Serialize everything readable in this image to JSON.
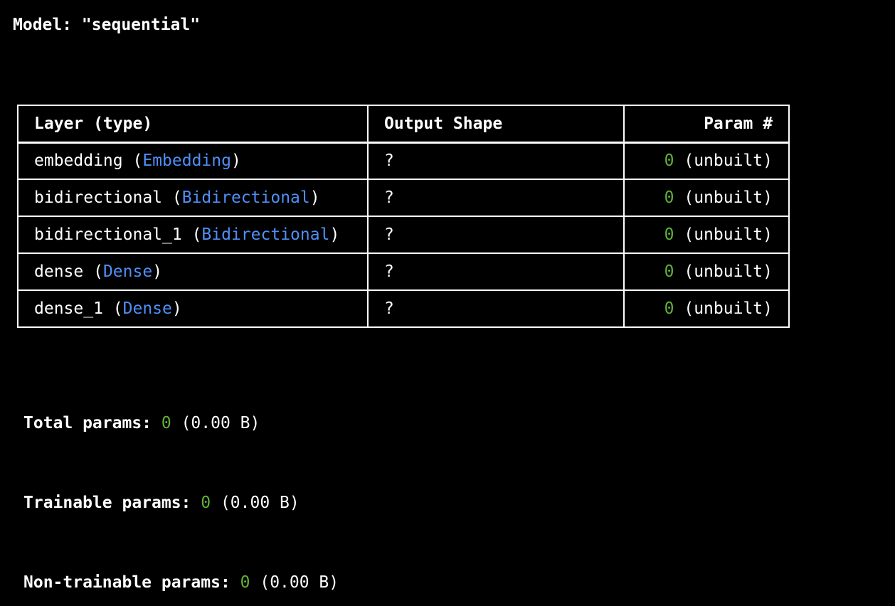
{
  "model": {
    "title": "Model: \"sequential\""
  },
  "table": {
    "headers": [
      "Layer (type)",
      "Output Shape",
      "Param #"
    ],
    "rows": [
      {
        "name": "embedding",
        "type": "Embedding",
        "shape": "?",
        "params": "0",
        "note": " (unbuilt)"
      },
      {
        "name": "bidirectional",
        "type": "Bidirectional",
        "shape": "?",
        "params": "0",
        "note": " (unbuilt)"
      },
      {
        "name": "bidirectional_1",
        "type": "Bidirectional",
        "shape": "?",
        "params": "0",
        "note": " (unbuilt)"
      },
      {
        "name": "dense",
        "type": "Dense",
        "shape": "?",
        "params": "0",
        "note": " (unbuilt)"
      },
      {
        "name": "dense_1",
        "type": "Dense",
        "shape": "?",
        "params": "0",
        "note": " (unbuilt)"
      }
    ]
  },
  "stats": {
    "total": {
      "label": "Total params: ",
      "value": "0",
      "size": " (0.00 B)"
    },
    "trainable": {
      "label": "Trainable params: ",
      "value": "0",
      "size": " (0.00 B)"
    },
    "non_trainable": {
      "label": "Non-trainable params: ",
      "value": "0",
      "size": " (0.00 B)"
    }
  },
  "colors": {
    "background": "#000000",
    "text": "#ffffff",
    "type_name": "#4f8ff7",
    "zero_value": "#5fb236"
  }
}
